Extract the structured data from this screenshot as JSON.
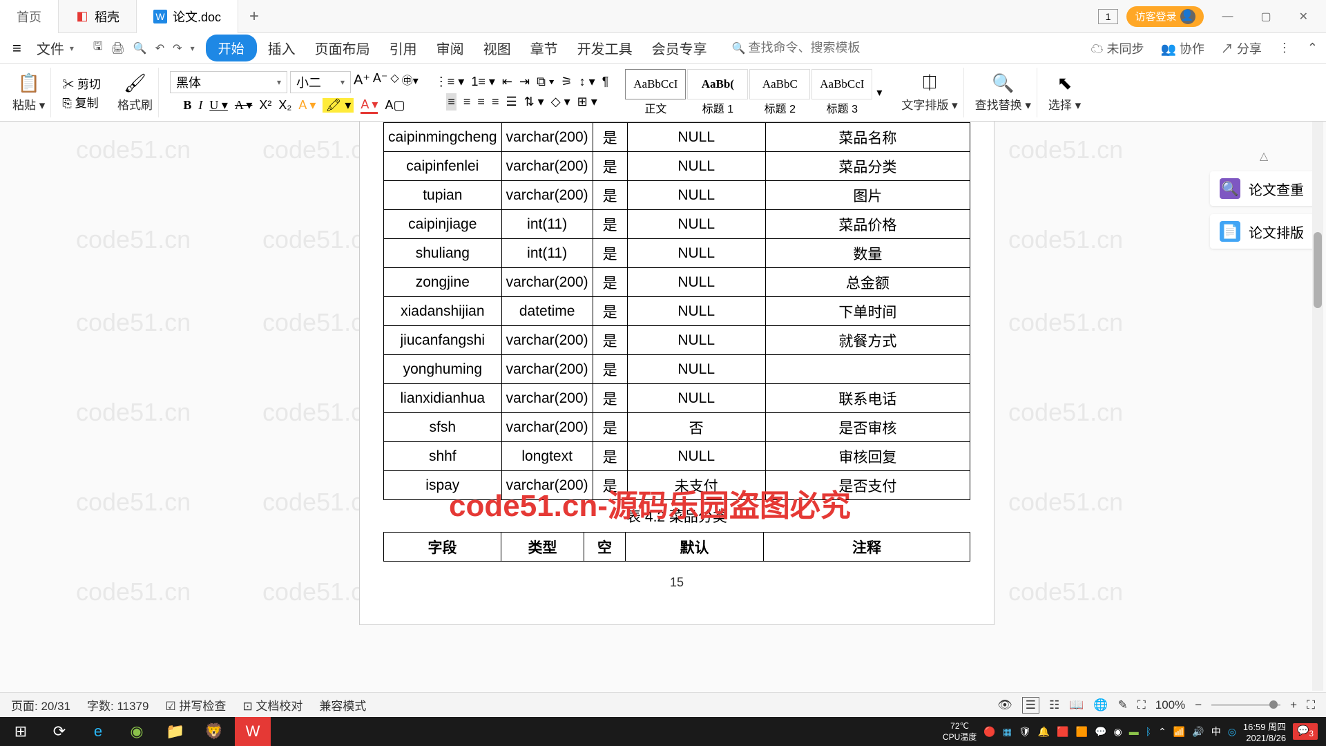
{
  "titlebar": {
    "home_tab": "首页",
    "daoke_tab": "稻壳",
    "doc_tab": "论文.doc",
    "badge_one": "1",
    "login": "访客登录"
  },
  "menubar": {
    "file": "文件",
    "start": "开始",
    "insert": "插入",
    "layout": "页面布局",
    "reference": "引用",
    "review": "审阅",
    "view": "视图",
    "chapter": "章节",
    "devtools": "开发工具",
    "member": "会员专享",
    "search_placeholder": "查找命令、搜索模板",
    "unsync": "未同步",
    "coop": "协作",
    "share": "分享"
  },
  "ribbon": {
    "paste": "粘贴",
    "cut": "剪切",
    "copy": "复制",
    "format_painter": "格式刷",
    "font_name": "黑体",
    "font_size": "小二",
    "styles": {
      "preview": "AaBbCcI",
      "preview_bold": "AaBb(",
      "preview2": "AaBbC",
      "preview3": "AaBbCcI",
      "body": "正文",
      "h1": "标题 1",
      "h2": "标题 2",
      "h3": "标题 3"
    },
    "text_layout": "文字排版",
    "find_replace": "查找替换",
    "select": "选择"
  },
  "right_panel": {
    "check": "论文查重",
    "typeset": "论文排版"
  },
  "table1": {
    "rows": [
      {
        "field": "caipinmingcheng",
        "type": "varchar(200)",
        "null": "是",
        "default": "NULL",
        "comment": "菜品名称"
      },
      {
        "field": "caipinfenlei",
        "type": "varchar(200)",
        "null": "是",
        "default": "NULL",
        "comment": "菜品分类"
      },
      {
        "field": "tupian",
        "type": "varchar(200)",
        "null": "是",
        "default": "NULL",
        "comment": "图片"
      },
      {
        "field": "caipinjiage",
        "type": "int(11)",
        "null": "是",
        "default": "NULL",
        "comment": "菜品价格"
      },
      {
        "field": "shuliang",
        "type": "int(11)",
        "null": "是",
        "default": "NULL",
        "comment": "数量"
      },
      {
        "field": "zongjine",
        "type": "varchar(200)",
        "null": "是",
        "default": "NULL",
        "comment": "总金额"
      },
      {
        "field": "xiadanshijian",
        "type": "datetime",
        "null": "是",
        "default": "NULL",
        "comment": "下单时间"
      },
      {
        "field": "jiucanfangshi",
        "type": "varchar(200)",
        "null": "是",
        "default": "NULL",
        "comment": "就餐方式"
      },
      {
        "field": "yonghuming",
        "type": "varchar(200)",
        "null": "是",
        "default": "NULL",
        "comment": ""
      },
      {
        "field": "lianxidianhua",
        "type": "varchar(200)",
        "null": "是",
        "default": "NULL",
        "comment": "联系电话"
      },
      {
        "field": "sfsh",
        "type": "varchar(200)",
        "null": "是",
        "default": "否",
        "comment": "是否审核"
      },
      {
        "field": "shhf",
        "type": "longtext",
        "null": "是",
        "default": "NULL",
        "comment": "审核回复"
      },
      {
        "field": "ispay",
        "type": "varchar(200)",
        "null": "是",
        "default": "未支付",
        "comment": "是否支付"
      }
    ]
  },
  "caption42": "表 4.2  菜品分类",
  "table2_headers": {
    "c0": "字段",
    "c1": "类型",
    "c2": "空",
    "c3": "默认",
    "c4": "注释"
  },
  "page_number": "15",
  "watermark": "code51.cn",
  "watermark_red": "code51.cn-源码乐园盗图必究",
  "statusbar": {
    "page_info": "页面: 20/31",
    "word_count": "字数: 11379",
    "spellcheck": "拼写检查",
    "doccheck": "文档校对",
    "compat": "兼容模式",
    "zoom": "100%"
  },
  "taskbar": {
    "cpu_temp": "72℃",
    "cpu_label": "CPU温度",
    "time": "16:59 周四",
    "date": "2021/8/26",
    "notif_count": "3"
  }
}
